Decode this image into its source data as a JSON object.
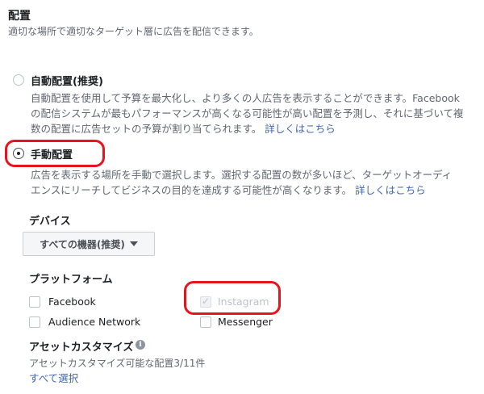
{
  "placement": {
    "title": "配置",
    "subtitle": "適切な場所で適切なターゲット層に広告を配信できます。"
  },
  "auto": {
    "label": "自動配置(推奨)",
    "desc_line1": "自動配置を使用して予算を最大化し、より多くの人広告を表示することができます。Facebook",
    "desc_line2": "の配信システムが最もパフォーマンスが高くなる可能性が高い配置を予測し、それに基づいて複",
    "desc_line3": "数の配置に広告セットの予算が割り当てられます。",
    "link": "詳しくはこちら",
    "selected": false
  },
  "manual": {
    "label": "手動配置",
    "desc_line1": "広告を表示する場所を手動で選択します。選択する配置の数が多いほど、ターゲットオーディ",
    "desc_line2": "エンスにリーチしてビジネスの目的を達成する可能性が高くなります。",
    "link": "詳しくはこちら",
    "selected": true
  },
  "devices": {
    "label": "デバイス",
    "selected": "すべての機器(推奨)"
  },
  "platforms": {
    "label": "プラットフォーム",
    "items": [
      {
        "label": "Facebook",
        "checked": false,
        "disabled": false
      },
      {
        "label": "Instagram",
        "checked": true,
        "disabled": true
      },
      {
        "label": "Audience Network",
        "checked": false,
        "disabled": false
      },
      {
        "label": "Messenger",
        "checked": false,
        "disabled": false
      }
    ]
  },
  "asset": {
    "label": "アセットカスタマイズ",
    "info_icon": "i",
    "count_text": "アセットカスタマイズ可能な配置3/11件",
    "select_all": "すべて選択"
  },
  "colors": {
    "link": "#4267b2",
    "highlight": "#e8141d",
    "muted_text": "#606770"
  }
}
